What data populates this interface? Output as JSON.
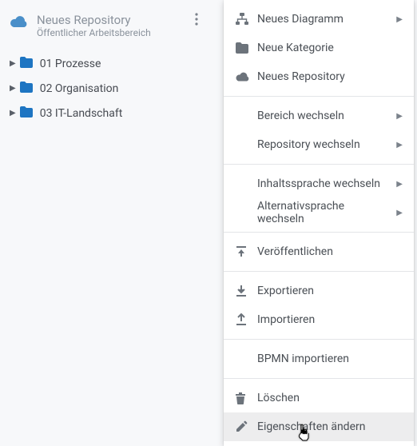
{
  "repo": {
    "title": "Neues Repository",
    "subtitle": "Öffentlicher Arbeitsbereich"
  },
  "tree": {
    "items": [
      {
        "label": "01 Prozesse"
      },
      {
        "label": "02 Organisation"
      },
      {
        "label": "03 IT-Landschaft"
      }
    ]
  },
  "menu": {
    "new_diagram": "Neues Diagramm",
    "new_category": "Neue Kategorie",
    "new_repository": "Neues Repository",
    "switch_area": "Bereich wechseln",
    "switch_repo": "Repository wechseln",
    "content_lang": "Inhaltssprache wechseln",
    "alt_lang": "Alternativsprache wechseln",
    "publish": "Veröffentlichen",
    "export": "Exportieren",
    "import": "Importieren",
    "bpmn_import": "BPMN importieren",
    "delete": "Löschen",
    "edit_props": "Eigenschaften ändern"
  }
}
